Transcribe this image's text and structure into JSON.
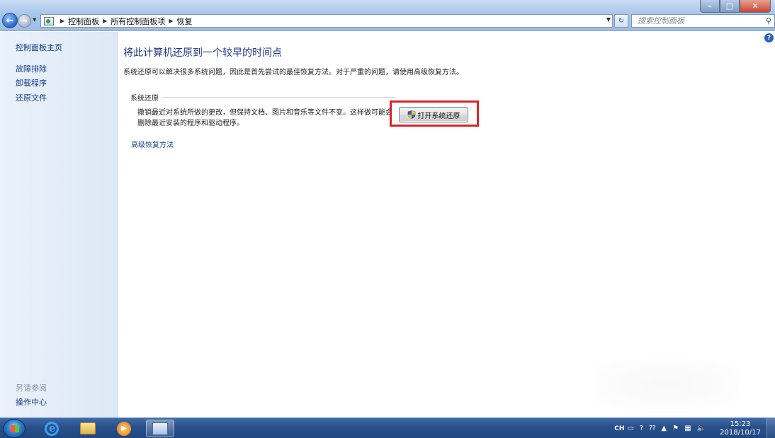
{
  "window": {
    "controls": {
      "minimize": "–",
      "maximize": "□",
      "close": "✕"
    }
  },
  "nav": {
    "back": "←",
    "forward": "→"
  },
  "address": {
    "breadcrumbs": [
      "控制面板",
      "所有控制面板项",
      "恢复"
    ]
  },
  "search": {
    "placeholder": "搜索控制面板"
  },
  "sidebar": {
    "items": [
      "控制面板主页",
      "故障排除",
      "卸载程序",
      "还原文件"
    ],
    "see_also_label": "另请参阅",
    "see_also_items": [
      "操作中心"
    ]
  },
  "main": {
    "title": "将此计算机还原到一个较早的时间点",
    "intro": "系统还原可以解决很多系统问题，因此是首先尝试的最佳恢复方法。对于严重的问题，请使用高级恢复方法。",
    "section_title": "系统还原",
    "section_desc": "撤销最近对系统所做的更改，但保持文档、图片和音乐等文件不变。这样做可能会删除最近安装的程序和驱动程序。",
    "restore_button": "打开系统还原",
    "advanced_link": "高级恢复方法",
    "help": "?"
  },
  "taskbar": {
    "language": "CH",
    "time": "15:23",
    "date": "2018/10/17"
  },
  "colors": {
    "link": "#0d3c8a",
    "title": "#1e3287",
    "highlight": "#d9242a",
    "taskbar": "#29508a"
  }
}
